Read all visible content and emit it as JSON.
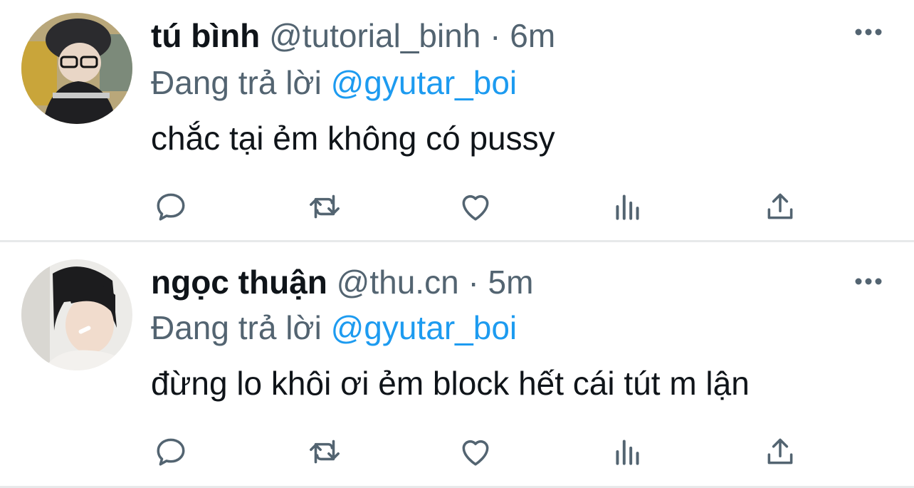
{
  "colors": {
    "text_primary": "#0f1419",
    "text_secondary": "#536471",
    "accent": "#1d9bf0",
    "divider": "#e7e9ea"
  },
  "tweets": [
    {
      "name": "tú bình",
      "handle": "@tutorial_binh",
      "separator": "·",
      "time": "6m",
      "reply_prefix": "Đang trả lời",
      "reply_mention": "@gyutar_boi",
      "text": "chắc tại ẻm không có pussy",
      "actions": [
        "reply-icon",
        "retweet-icon",
        "like-icon",
        "views-icon",
        "share-icon"
      ]
    },
    {
      "name": "ngọc thuận",
      "handle": "@thu.cn",
      "separator": "·",
      "time": "5m",
      "reply_prefix": "Đang trả lời",
      "reply_mention": "@gyutar_boi",
      "text": "đừng lo khôi ơi ẻm block hết cái tút m lận",
      "actions": [
        "reply-icon",
        "retweet-icon",
        "like-icon",
        "views-icon",
        "share-icon"
      ]
    }
  ]
}
